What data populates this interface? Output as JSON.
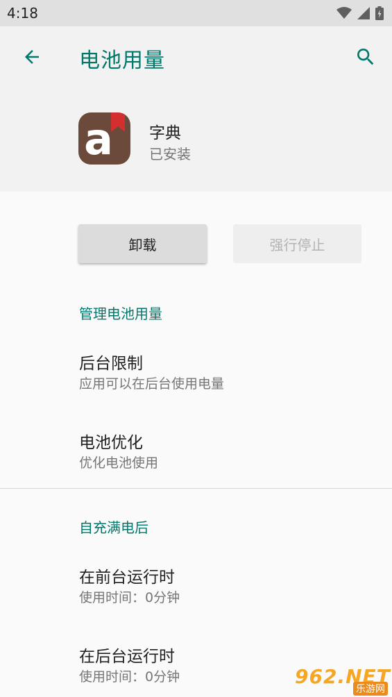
{
  "status_bar": {
    "time": "4:18"
  },
  "app_bar": {
    "title": "电池用量",
    "back_icon": "arrow-back-icon",
    "search_icon": "search-icon",
    "accent_color": "#00796b"
  },
  "app": {
    "name": "字典",
    "status": "已安装",
    "icon_letter": "a"
  },
  "buttons": {
    "uninstall": "卸载",
    "force_stop": "强行停止"
  },
  "manage_section": {
    "header": "管理电池用量",
    "items": [
      {
        "title": "后台限制",
        "summary": "应用可以在后台使用电量"
      },
      {
        "title": "电池优化",
        "summary": "优化电池使用"
      }
    ]
  },
  "since_charge_section": {
    "header": "自充满电后",
    "items": [
      {
        "title": "在前台运行时",
        "summary": "使用时间：0分钟"
      },
      {
        "title": "在后台运行时",
        "summary": "使用时间：0分钟"
      }
    ]
  },
  "watermark": {
    "main": "962.NET",
    "sub": "乐游网"
  }
}
